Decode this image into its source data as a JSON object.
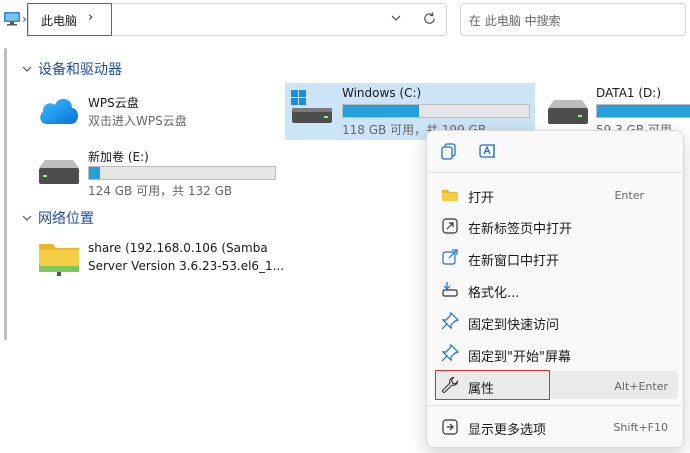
{
  "address": {
    "breadcrumb": "此电脑"
  },
  "search": {
    "placeholder": "在 此电脑 中搜索"
  },
  "groups": {
    "devices": "设备和驱动器",
    "network": "网络位置"
  },
  "items": {
    "wps": {
      "title": "WPS云盘",
      "sub": "双击进入WPS云盘"
    },
    "c": {
      "title": "Windows (C:)",
      "sub": "118 GB 可用，共 199 GB",
      "used_fraction": 0.41
    },
    "d": {
      "title": "DATA1 (D:)",
      "sub": "59.3 GB 可用，共",
      "used_fraction": 0.9
    },
    "e": {
      "title": "新加卷 (E:)",
      "sub": "124 GB 可用，共 132 GB",
      "used_fraction": 0.06
    },
    "share": {
      "line1": "share (192.168.0.106 (Samba",
      "line2": "Server Version 3.6.23-53.el6_1..."
    }
  },
  "menu": {
    "items": [
      {
        "label": "打开",
        "shortcut": "Enter",
        "icon": "folder-icon"
      },
      {
        "label": "在新标签页中打开",
        "shortcut": "",
        "icon": "new-tab-icon"
      },
      {
        "label": "在新窗口中打开",
        "shortcut": "",
        "icon": "new-window-icon"
      },
      {
        "label": "格式化...",
        "shortcut": "",
        "icon": "format-icon"
      },
      {
        "label": "固定到快速访问",
        "shortcut": "",
        "icon": "pin-icon"
      },
      {
        "label": "固定到\"开始\"屏幕",
        "shortcut": "",
        "icon": "pin-start-icon"
      },
      {
        "label": "属性",
        "shortcut": "Alt+Enter",
        "icon": "wrench-icon"
      },
      {
        "label": "显示更多选项",
        "shortcut": "Shift+F10",
        "icon": "more-options-icon"
      }
    ]
  },
  "colors": {
    "accent": "#26a0da",
    "group_header": "#1f4e9e",
    "highlight_box": "#d9333a"
  }
}
